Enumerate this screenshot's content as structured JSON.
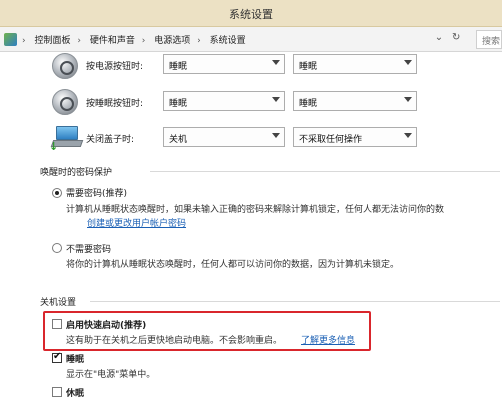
{
  "window": {
    "title": "系统设置"
  },
  "address": {
    "crumbs": [
      "控制面板",
      "硬件和声音",
      "电源选项",
      "系统设置"
    ],
    "search_placeholder": "搜索"
  },
  "buttons": [
    {
      "label": "按电源按钮时:",
      "value1": "睡眠",
      "value2": "睡眠"
    },
    {
      "label": "按睡眠按钮时:",
      "value1": "睡眠",
      "value2": "睡眠"
    },
    {
      "label": "关闭盖子时:",
      "value1": "关机",
      "value2": "不采取任何操作"
    }
  ],
  "password": {
    "title": "唤醒时的密码保护",
    "require": {
      "label": "需要密码(推荐)",
      "desc": "计算机从睡眠状态唤醒时，如果未输入正确的密码来解除计算机锁定，任何人都无法访问你的数",
      "link": "创建或更改用户帐户密码"
    },
    "norequire": {
      "label": "不需要密码",
      "desc": "将你的计算机从睡眠状态唤醒时，任何人都可以访问你的数据，因为计算机未锁定。"
    }
  },
  "shutdown": {
    "title": "关机设置",
    "fast_startup": {
      "label": "启用快速启动(推荐)",
      "desc": "这有助于在关机之后更快地启动电脑。不会影响重启。",
      "link": "了解更多信息",
      "checked": false
    },
    "sleep": {
      "label": "睡眠",
      "desc": "显示在\"电源\"菜单中。",
      "checked": true
    },
    "hibernate": {
      "label": "休眠",
      "checked": false
    }
  },
  "colors": {
    "highlight_box": "#d9262c",
    "link": "#1a5fb4",
    "titlebar": "#ece1c4"
  }
}
